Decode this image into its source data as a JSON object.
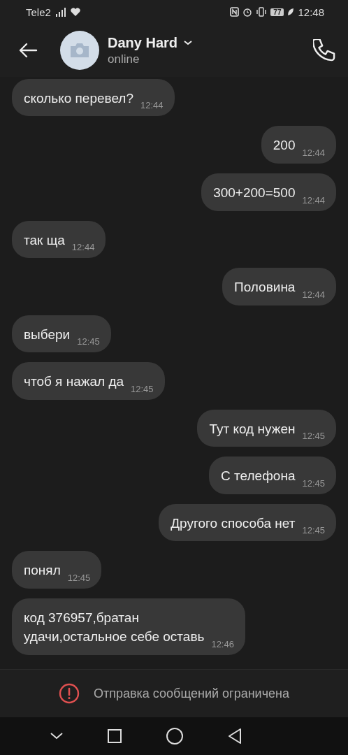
{
  "status_bar": {
    "carrier": "Tele2",
    "time": "12:48",
    "battery": "77"
  },
  "header": {
    "name": "Dany Hard",
    "status": "online"
  },
  "messages": [
    {
      "kind": "received",
      "text": "сколько перевел?",
      "time": "12:44"
    },
    {
      "kind": "sent",
      "text": "200",
      "time": "12:44"
    },
    {
      "kind": "sent",
      "text": "300+200=500",
      "time": "12:44"
    },
    {
      "kind": "received",
      "text": "так ща",
      "time": "12:44"
    },
    {
      "kind": "sent",
      "text": "Половина",
      "time": "12:44"
    },
    {
      "kind": "received",
      "text": "выбери",
      "time": "12:45"
    },
    {
      "kind": "received",
      "text": "чтоб я нажал да",
      "time": "12:45"
    },
    {
      "kind": "sent",
      "text": "Тут код нужен",
      "time": "12:45"
    },
    {
      "kind": "sent",
      "text": "С телефона",
      "time": "12:45"
    },
    {
      "kind": "sent",
      "text": "Другого способа нет",
      "time": "12:45"
    },
    {
      "kind": "received",
      "text": "понял",
      "time": "12:45"
    },
    {
      "kind": "received",
      "text": "код 376957,братан\nудачи,остальное себе оставь",
      "time": "12:46"
    }
  ],
  "notice": "Отправка сообщений ограничена"
}
